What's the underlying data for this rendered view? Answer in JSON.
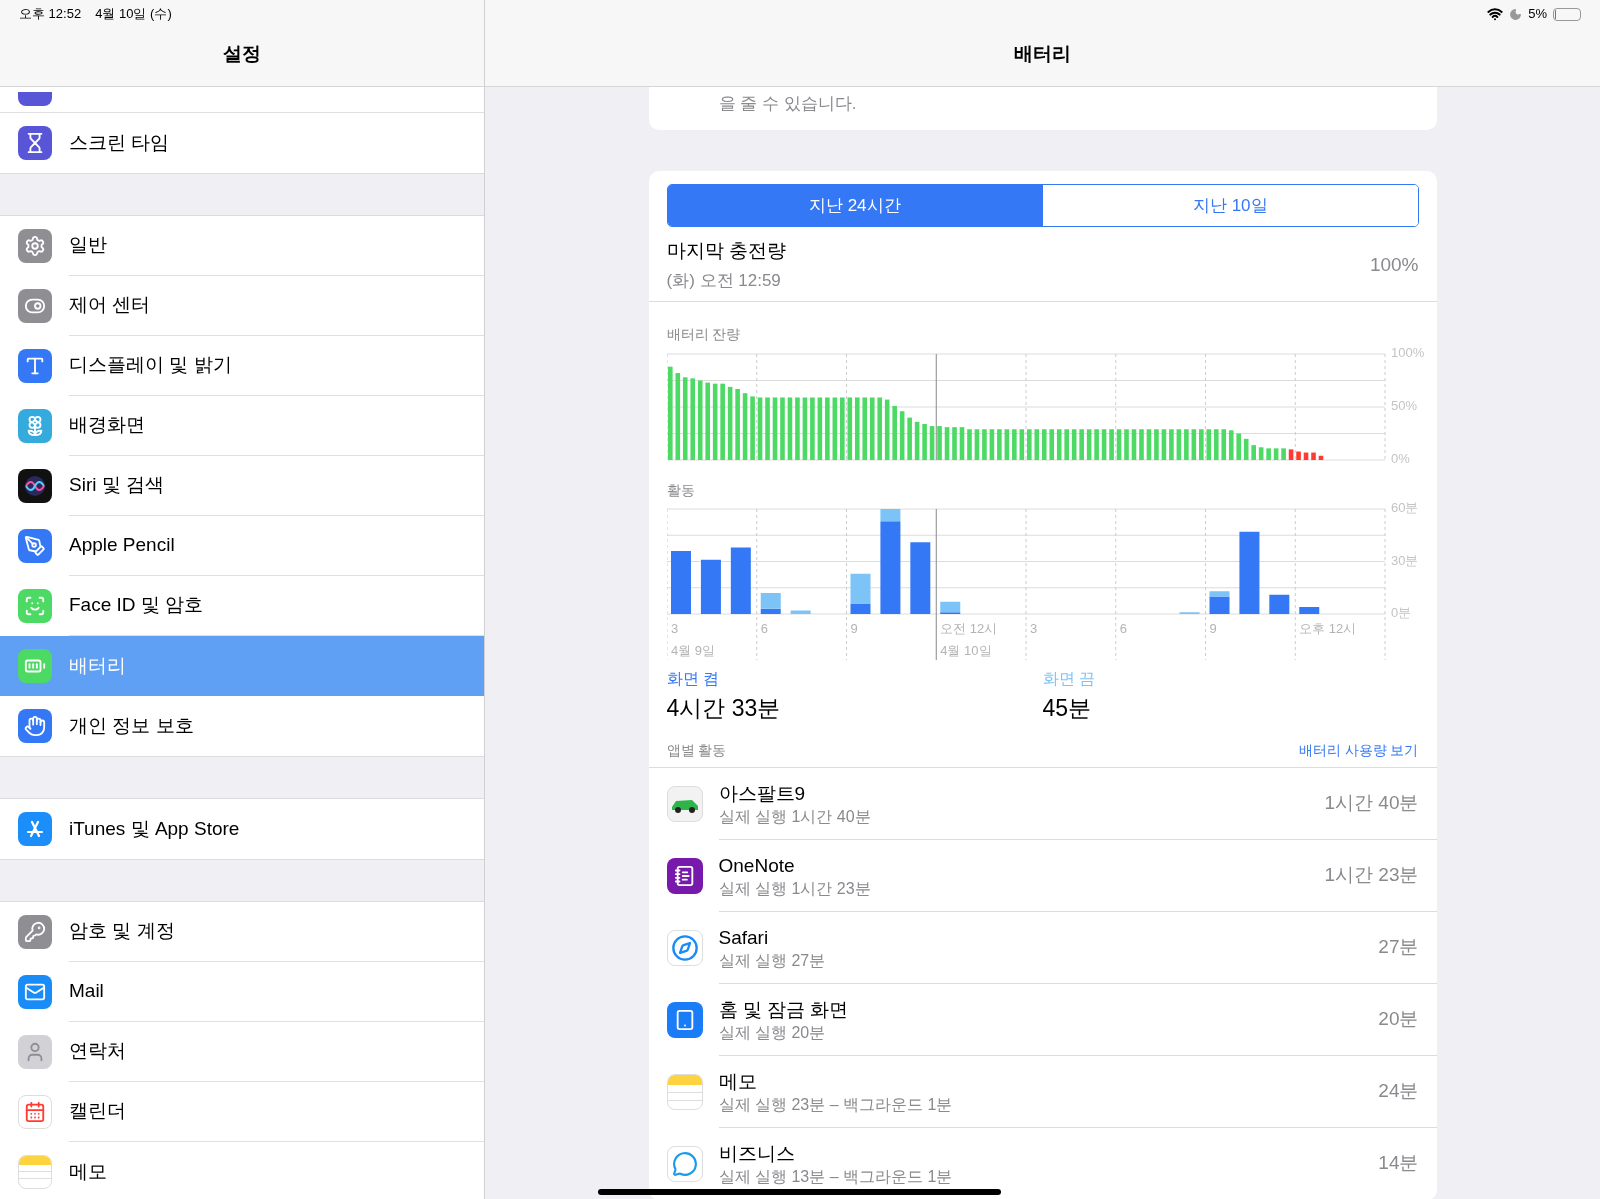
{
  "status_bar": {
    "time": "오후 12:52",
    "date": "4월 10일 (수)",
    "battery_text": "5%",
    "battery": {
      "level": 0.05
    }
  },
  "sidebar": {
    "title": "설정",
    "groups": [
      {
        "items": [
          {
            "kind": "screen-time",
            "label": "스크린 타임",
            "selected": false
          }
        ]
      },
      {
        "items": [
          {
            "kind": "general",
            "label": "일반",
            "selected": false
          },
          {
            "kind": "control-center",
            "label": "제어 센터",
            "selected": false
          },
          {
            "kind": "display",
            "label": "디스플레이 및 밝기",
            "selected": false
          },
          {
            "kind": "wallpaper",
            "label": "배경화면",
            "selected": false
          },
          {
            "kind": "siri",
            "label": "Siri 및 검색",
            "selected": false
          },
          {
            "kind": "pencil",
            "label": "Apple Pencil",
            "selected": false
          },
          {
            "kind": "faceid",
            "label": "Face ID 및 암호",
            "selected": false
          },
          {
            "kind": "battery",
            "label": "배터리",
            "selected": true
          },
          {
            "kind": "privacy",
            "label": "개인 정보 보호",
            "selected": false
          }
        ]
      },
      {
        "items": [
          {
            "kind": "appstore",
            "label": "iTunes 및 App Store",
            "selected": false
          }
        ]
      },
      {
        "items": [
          {
            "kind": "passwords",
            "label": "암호 및 계정",
            "selected": false
          },
          {
            "kind": "mail",
            "label": "Mail",
            "selected": false
          },
          {
            "kind": "contacts",
            "label": "연락처",
            "selected": false
          },
          {
            "kind": "calendar",
            "label": "캘린더",
            "selected": false
          },
          {
            "kind": "notes",
            "label": "메모",
            "selected": false
          }
        ]
      }
    ]
  },
  "detail": {
    "title": "배터리",
    "note_tail": "을 줄 수 있습니다.",
    "tabs": [
      {
        "label": "지난 24시간",
        "selected": true
      },
      {
        "label": "지난 10일",
        "selected": false
      }
    ],
    "last_charge": {
      "label": "마지막 충전량",
      "time": "(화) 오전 12:59",
      "value": "100%"
    },
    "battery_level": {
      "chart_data": {
        "type": "bar",
        "title": "배터리 잔량",
        "stacked": true,
        "categories": [
          null,
          null,
          null,
          null,
          null,
          null,
          null,
          null,
          null,
          null,
          null,
          null,
          null,
          null,
          null,
          null,
          null,
          null,
          null,
          null,
          null,
          null,
          null,
          null,
          null,
          null,
          null,
          null,
          null,
          null,
          null,
          null,
          null,
          null,
          null,
          null,
          null,
          null,
          null,
          null,
          null,
          null,
          null,
          null,
          null,
          null,
          null,
          null,
          null,
          null,
          null,
          null,
          null,
          null,
          null,
          null,
          null,
          null,
          null,
          null,
          null,
          null,
          null,
          null,
          null,
          null,
          null,
          null,
          null,
          null,
          null,
          null,
          null,
          null,
          null,
          null,
          null,
          null,
          null,
          null,
          null,
          null,
          null,
          null,
          null,
          null,
          null,
          null
        ],
        "ylim": [
          0,
          100
        ],
        "yticks": [
          {
            "value": 0,
            "label": "0%"
          },
          {
            "value": 50,
            "label": "50%"
          },
          {
            "value": 100,
            "label": "100%"
          }
        ],
        "series": [
          {
            "color": "#4cd964",
            "values": [
              88,
              82,
              78,
              77,
              75,
              73,
              72,
              72,
              69,
              67,
              63,
              60,
              59,
              59,
              59,
              59,
              59,
              59,
              59,
              59,
              59,
              59,
              59,
              59,
              59,
              59,
              59,
              59,
              59,
              57,
              51,
              46,
              40,
              36,
              34,
              32,
              32,
              31,
              31,
              31,
              29,
              29,
              29,
              29,
              29,
              29,
              29,
              29,
              29,
              29,
              29,
              29,
              29,
              29,
              29,
              29,
              29,
              29,
              29,
              29,
              29,
              29,
              29,
              29,
              29,
              29,
              29,
              29,
              29,
              29,
              29,
              29,
              29,
              29,
              29,
              28,
              25,
              20,
              14,
              12,
              11,
              11,
              11,
              null,
              null,
              null,
              null,
              null
            ]
          },
          {
            "color": "#ff3b30",
            "values": [
              null,
              null,
              null,
              null,
              null,
              null,
              null,
              null,
              null,
              null,
              null,
              null,
              null,
              null,
              null,
              null,
              null,
              null,
              null,
              null,
              null,
              null,
              null,
              null,
              null,
              null,
              null,
              null,
              null,
              null,
              null,
              null,
              null,
              null,
              null,
              null,
              null,
              null,
              null,
              null,
              null,
              null,
              null,
              null,
              null,
              null,
              null,
              null,
              null,
              null,
              null,
              null,
              null,
              null,
              null,
              null,
              null,
              null,
              null,
              null,
              null,
              null,
              null,
              null,
              null,
              null,
              null,
              null,
              null,
              null,
              null,
              null,
              null,
              null,
              null,
              null,
              null,
              null,
              null,
              null,
              null,
              null,
              null,
              10,
              8,
              7,
              7,
              4
            ]
          }
        ]
      }
    },
    "activity": {
      "chart_data": {
        "type": "bar",
        "title": "활동",
        "stacked": true,
        "ylim": [
          0,
          60
        ],
        "yticks": [
          {
            "value": 0,
            "label": "0분"
          },
          {
            "value": 30,
            "label": "30분"
          },
          {
            "value": 60,
            "label": "60분"
          }
        ],
        "categories": [
          "3",
          null,
          null,
          "6",
          null,
          null,
          "9",
          null,
          null,
          "오전 12시",
          null,
          null,
          "3",
          null,
          null,
          "6",
          null,
          null,
          "9",
          null,
          null,
          "오후 12시",
          null,
          null
        ],
        "annotations": [
          "4월 9일",
          "4월 10일"
        ],
        "series": [
          {
            "name": "화면 켬",
            "color": "#3478f6",
            "values": [
              36,
              31,
              38,
              3,
              0,
              0,
              6,
              53,
              41,
              1,
              0,
              0,
              0,
              0,
              0,
              0,
              0,
              0,
              10,
              47,
              11,
              4,
              0,
              0
            ]
          },
          {
            "name": "화면 끔",
            "color": "#7cc4f8",
            "values": [
              0,
              0,
              0,
              9,
              2,
              0,
              17,
              7,
              0,
              6,
              0,
              0,
              0,
              0,
              0,
              0,
              0,
              1,
              3,
              0,
              0,
              0,
              0,
              0
            ]
          }
        ]
      }
    },
    "legend": [
      {
        "value": "4시간 33분"
      },
      {
        "value": "45분"
      }
    ],
    "app_activity": {
      "title": "앱별 활동",
      "link": "배터리 사용량 보기",
      "apps": [
        {
          "kind": "racing",
          "name": "아스팔트9",
          "detail": "실제 실행 1시간 40분",
          "time": "1시간 40분"
        },
        {
          "kind": "onenote",
          "name": "OneNote",
          "detail": "실제 실행 1시간 23분",
          "time": "1시간 23분"
        },
        {
          "kind": "safari",
          "name": "Safari",
          "detail": "실제 실행 27분",
          "time": "27분"
        },
        {
          "kind": "home",
          "name": "홈 및 잠금 화면",
          "detail": "실제 실행 20분",
          "time": "20분"
        },
        {
          "kind": "notes",
          "name": "메모",
          "detail": "실제 실행 23분 – 백그라운드 1분",
          "time": "24분"
        },
        {
          "kind": "skype",
          "name": "비즈니스",
          "detail": "실제 실행 13분 – 백그라운드 1분",
          "time": "14분"
        }
      ]
    }
  }
}
